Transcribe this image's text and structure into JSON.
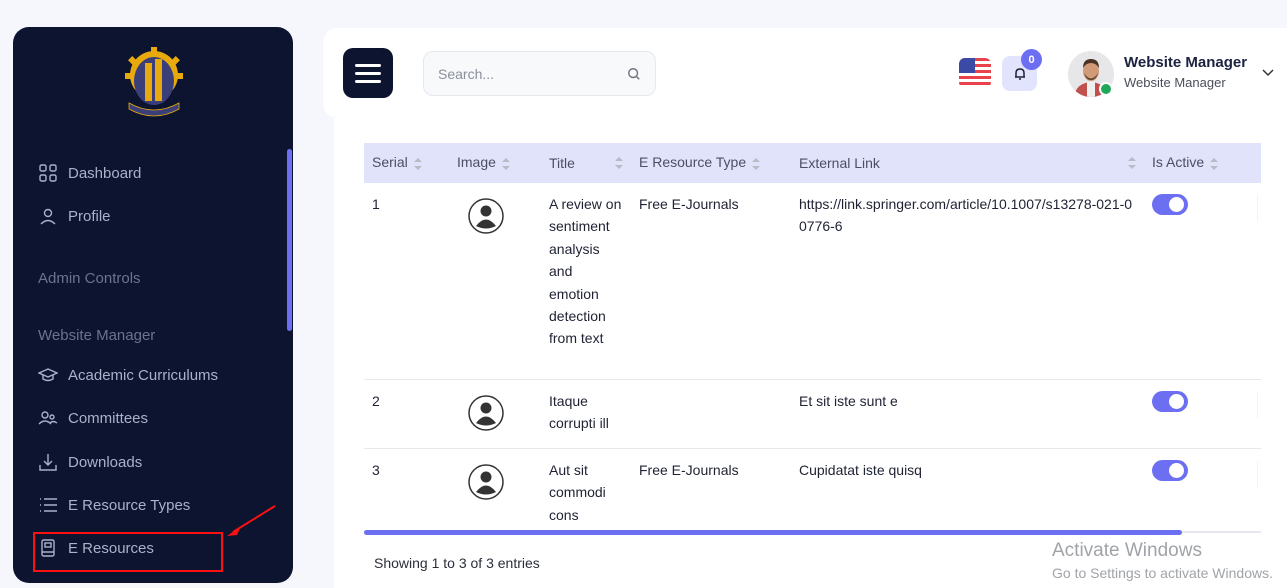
{
  "sidebar": {
    "logo_alt": "CUET emblem",
    "items": [
      {
        "label": "Dashboard",
        "icon": "grid-icon"
      },
      {
        "label": "Profile",
        "icon": "user-icon"
      }
    ],
    "sections": [
      {
        "label": "Admin Controls"
      },
      {
        "label": "Website Manager"
      }
    ],
    "manager_items": [
      {
        "label": "Academic Curriculums",
        "icon": "graduation-cap-icon"
      },
      {
        "label": "Committees",
        "icon": "users-icon"
      },
      {
        "label": "Downloads",
        "icon": "download-icon"
      },
      {
        "label": "E Resource Types",
        "icon": "list-icon"
      },
      {
        "label": "E Resources",
        "icon": "book-icon",
        "active": true
      }
    ]
  },
  "header": {
    "search_placeholder": "Search...",
    "notification_count": "0",
    "user": {
      "name": "Website Manager",
      "role": "Website Manager"
    }
  },
  "table": {
    "columns": [
      "Serial",
      "Image",
      "Title",
      "E Resource Type",
      "External Link",
      "Is Active"
    ],
    "rows": [
      {
        "serial": "1",
        "title": "A review on sentiment analysis and emotion detection from text",
        "type": "Free E-Journals",
        "link": "https://link.springer.com/article/10.1007/s13278-021-00776-6",
        "active": true
      },
      {
        "serial": "2",
        "title": "Itaque corrupti ill",
        "type": "",
        "link": "Et sit iste sunt e",
        "active": true
      },
      {
        "serial": "3",
        "title": "Aut sit commodi cons",
        "type": "Free E-Journals",
        "link": "Cupidatat iste quisq",
        "active": true
      }
    ],
    "footer": "Showing 1 to 3 of 3 entries"
  },
  "watermark": {
    "title": "Activate Windows",
    "subtitle": "Go to Settings to activate Windows."
  },
  "colors": {
    "sidebar_bg": "#0c1430",
    "accent": "#6c6ff2",
    "header_row": "#e1e3fb",
    "annotation": "#ff1010"
  }
}
